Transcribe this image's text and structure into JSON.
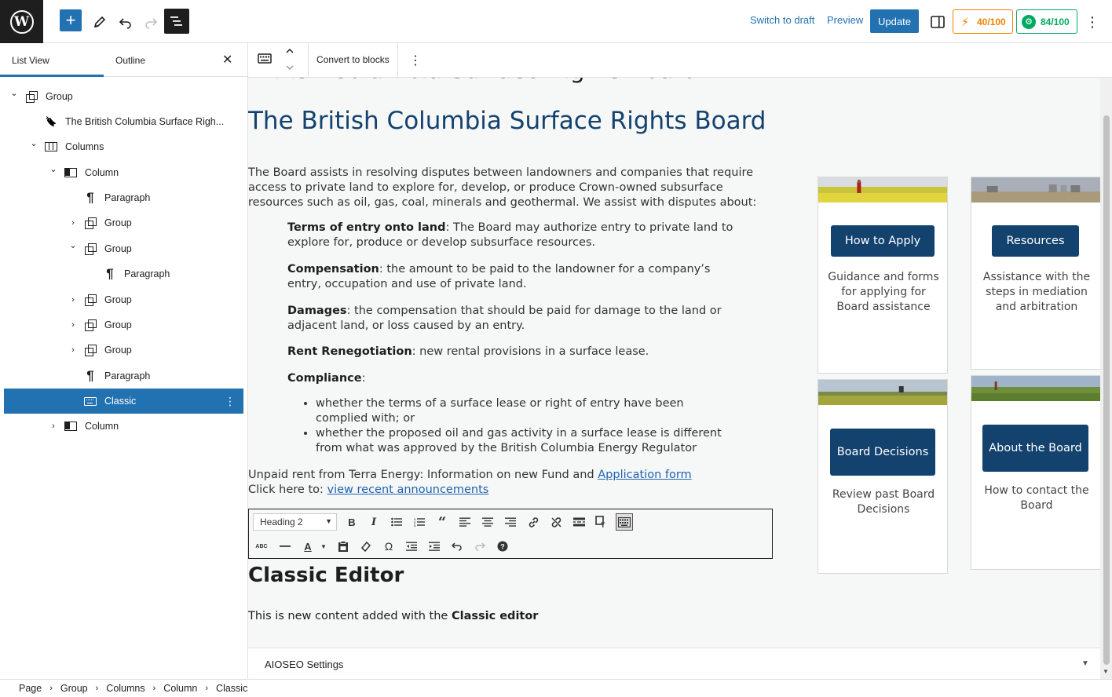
{
  "topbar": {
    "logo": "W",
    "add_icon": "+",
    "tools_icon": "pencil-icon",
    "undo_icon": "undo-icon",
    "redo_icon": "redo-icon",
    "list_view_icon": "list-view-icon",
    "switch_to_draft": "Switch to draft",
    "preview": "Preview",
    "update": "Update",
    "settings_icon": "sidebar-toggle-icon",
    "score_orange": "40/100",
    "score_green": "84/100",
    "more_icon": "⋮"
  },
  "sidebar": {
    "tab_list_view": "List View",
    "tab_outline": "Outline",
    "close": "✕",
    "items": [
      {
        "label": "Group",
        "chevron": "⌄",
        "icon": "group"
      },
      {
        "label": "The British Columbia Surface Righ...",
        "chevron": "",
        "icon": "bookmark"
      },
      {
        "label": "Columns",
        "chevron": "⌄",
        "icon": "columns"
      },
      {
        "label": "Column",
        "chevron": "⌄",
        "icon": "column"
      },
      {
        "label": "Paragraph",
        "chevron": "",
        "icon": "paragraph"
      },
      {
        "label": "Group",
        "chevron": "›",
        "icon": "group"
      },
      {
        "label": "Group",
        "chevron": "⌄",
        "icon": "group"
      },
      {
        "label": "Paragraph",
        "chevron": "",
        "icon": "paragraph"
      },
      {
        "label": "Group",
        "chevron": "›",
        "icon": "group"
      },
      {
        "label": "Group",
        "chevron": "›",
        "icon": "group"
      },
      {
        "label": "Group",
        "chevron": "›",
        "icon": "group"
      },
      {
        "label": "Paragraph",
        "chevron": "",
        "icon": "paragraph"
      },
      {
        "label": "Classic",
        "chevron": "",
        "icon": "keyboard"
      },
      {
        "label": "Column",
        "chevron": "›",
        "icon": "column"
      }
    ]
  },
  "block_toolbar": {
    "convert": "Convert to blocks",
    "more": "⋮"
  },
  "content": {
    "cut_heading": "British Columbia Surface Rights Board",
    "heading": "The British Columbia Surface Rights Board",
    "intro": "The Board assists in resolving disputes between landowners and companies that require access to private land to explore for, develop, or produce Crown-owned subsurface resources such as oil, gas, coal, minerals and geothermal. We assist with disputes about:",
    "items": [
      {
        "term": "Terms of entry onto land",
        "text": ": The Board may authorize entry to private land to explore for, produce or develop subsurface resources."
      },
      {
        "term": "Compensation",
        "text": ": the amount to be paid to the landowner for a company’s entry, occupation and use of private land."
      },
      {
        "term": "Damages",
        "text": ": the compensation that should be paid for damage to the land or adjacent land, or loss caused by an entry."
      },
      {
        "term": "Rent Renegotiation",
        "text": ": new rental provisions in a surface lease."
      },
      {
        "term": "Compliance",
        "text": ":"
      }
    ],
    "bullets": [
      "whether the terms of a surface lease or right of entry have been complied with; or",
      "whether the proposed oil and gas activity in a surface lease is different from what was approved by the British Columbia Energy Regulator"
    ],
    "unpaid_text": "Unpaid rent from Terra Energy: Information on new Fund and ",
    "unpaid_link": "Application form",
    "click_text": "Click here to: ",
    "click_link": "view recent announcements"
  },
  "classic": {
    "format_select": "Heading 2",
    "heading": "Classic Editor",
    "para_prefix": "This is new content added with the ",
    "para_bold": "Classic editor"
  },
  "cards": [
    {
      "button": "How to Apply",
      "desc": "Guidance and forms for applying for Board assistance"
    },
    {
      "button": "Resources",
      "desc": "Assistance with the steps in mediation and arbitration"
    },
    {
      "button": "Board Decisions",
      "desc": "Review past Board Decisions"
    },
    {
      "button": "About the Board",
      "desc": "How to contact the Board"
    }
  ],
  "aioseo": {
    "title": "AIOSEO Settings",
    "chevron": "▼"
  },
  "breadcrumb": [
    "Page",
    "Group",
    "Columns",
    "Column",
    "Classic"
  ]
}
